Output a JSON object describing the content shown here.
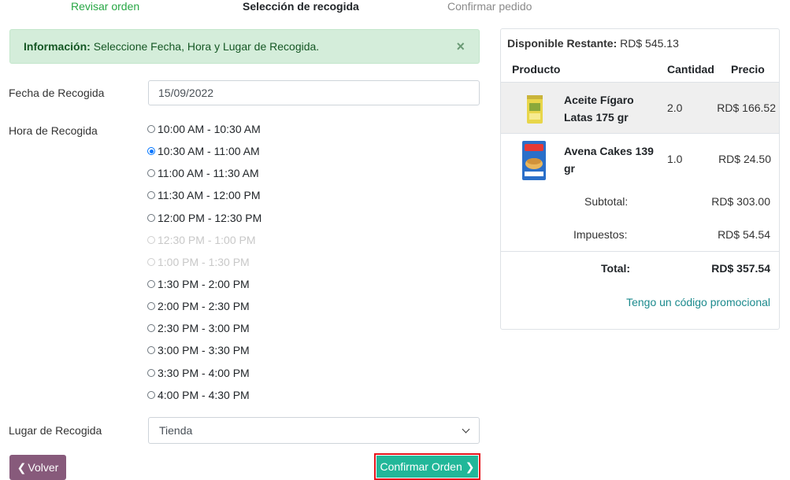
{
  "steps": {
    "review": "Revisar orden",
    "pickup": "Selección de recogida",
    "confirm": "Confirmar pedido"
  },
  "alert": {
    "title": "Información:",
    "message": "Seleccione Fecha, Hora y Lugar de Recogida.",
    "close": "×"
  },
  "form": {
    "date_label": "Fecha de Recogida",
    "date_value": "15/09/2022",
    "time_label": "Hora de Recogida",
    "time_slots": [
      {
        "label": "10:00 AM - 10:30 AM",
        "selected": false,
        "disabled": false
      },
      {
        "label": "10:30 AM - 11:00 AM",
        "selected": true,
        "disabled": false
      },
      {
        "label": "11:00 AM - 11:30 AM",
        "selected": false,
        "disabled": false
      },
      {
        "label": "11:30 AM - 12:00 PM",
        "selected": false,
        "disabled": false
      },
      {
        "label": "12:00 PM - 12:30 PM",
        "selected": false,
        "disabled": false
      },
      {
        "label": "12:30 PM - 1:00 PM",
        "selected": false,
        "disabled": true
      },
      {
        "label": "1:00 PM - 1:30 PM",
        "selected": false,
        "disabled": true
      },
      {
        "label": "1:30 PM - 2:00 PM",
        "selected": false,
        "disabled": false
      },
      {
        "label": "2:00 PM - 2:30 PM",
        "selected": false,
        "disabled": false
      },
      {
        "label": "2:30 PM - 3:00 PM",
        "selected": false,
        "disabled": false
      },
      {
        "label": "3:00 PM - 3:30 PM",
        "selected": false,
        "disabled": false
      },
      {
        "label": "3:30 PM - 4:00 PM",
        "selected": false,
        "disabled": false
      },
      {
        "label": "4:00 PM - 4:30 PM",
        "selected": false,
        "disabled": false
      }
    ],
    "place_label": "Lugar de Recogida",
    "place_value": "Tienda"
  },
  "buttons": {
    "back": "Volver",
    "confirm": "Confirmar Orden"
  },
  "cart": {
    "available_label": "Disponible Restante:",
    "available_value": "RD$ 545.13",
    "col_product": "Producto",
    "col_qty": "Cantidad",
    "col_price": "Precio",
    "items": [
      {
        "name": "Aceite Fígaro Latas 175 gr",
        "qty": "2.0",
        "price": "RD$ 166.52"
      },
      {
        "name": "Avena Cakes 139 gr",
        "qty": "1.0",
        "price": "RD$ 24.50"
      }
    ],
    "subtotal_label": "Subtotal:",
    "subtotal_value": "RD$ 303.00",
    "tax_label": "Impuestos:",
    "tax_value": "RD$ 54.54",
    "total_label": "Total:",
    "total_value": "RD$ 357.54",
    "promo": "Tengo un código promocional"
  },
  "colors": {
    "accent_green": "#28a745",
    "confirm_button": "#21b799",
    "back_button": "#875a7b",
    "highlight_border": "#e8141c",
    "promo_link": "#1b8a8d"
  }
}
